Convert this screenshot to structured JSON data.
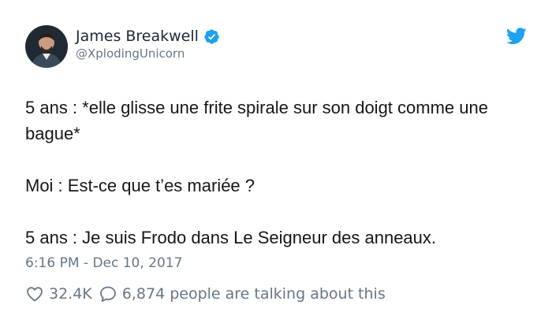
{
  "author": {
    "name": "James Breakwell",
    "handle": "@XplodingUnicorn",
    "verified": true
  },
  "tweet": {
    "paragraphs": [
      "5 ans : *elle glisse une frite spirale sur son doigt comme une bague*",
      "Moi : Est-ce que t’es mariée ?",
      "5 ans : Je suis Frodo dans Le Seigneur des anneaux."
    ],
    "timestamp": "6:16 PM - Dec 10, 2017"
  },
  "actions": {
    "likes": "32.4K",
    "talking": "6,874 people are talking about this"
  },
  "icons": {
    "verified": "verified-badge-icon",
    "brand": "twitter-bird-icon",
    "like": "heart-icon",
    "reply": "speech-bubble-icon"
  },
  "colors": {
    "brand_blue": "#1da1f2",
    "secondary_text": "#657786",
    "primary_text": "#14171a"
  }
}
